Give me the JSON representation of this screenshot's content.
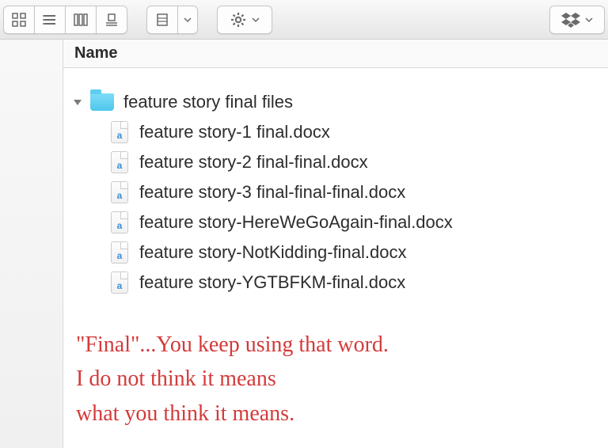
{
  "toolbar": {
    "view_icons_label": "icon-view",
    "view_list_label": "list-view",
    "view_columns_label": "column-view",
    "view_coverflow_label": "coverflow-view"
  },
  "header": {
    "name_label": "Name"
  },
  "tree": {
    "folder_name": "feature story final files",
    "files": [
      "feature story-1 final.docx",
      "feature story-2 final-final.docx",
      "feature story-3 final-final-final.docx",
      "feature story-HereWeGoAgain-final.docx",
      "feature story-NotKidding-final.docx",
      "feature story-YGTBFKM-final.docx"
    ],
    "file_glyph": "a"
  },
  "annotation": {
    "line1": "\"Final\"...You keep using that word.",
    "line2": "I do not think it means",
    "line3": "what you think it means."
  }
}
